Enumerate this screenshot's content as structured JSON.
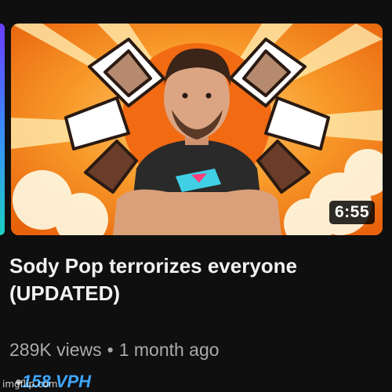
{
  "video": {
    "title": "Sody Pop terrorizes everyone (UPDATED)",
    "duration": "6:55",
    "views": "289K views",
    "separator": "•",
    "age": "1 month ago",
    "vph": "158 VPH"
  },
  "watermark": "imgflip.com",
  "colors": {
    "background": "#0f0f0f",
    "thumbnail_orange": "#f58b1e",
    "vph_blue": "#3ea6ff",
    "meta_gray": "#aaaaaa",
    "title_white": "#f1f1f1"
  }
}
